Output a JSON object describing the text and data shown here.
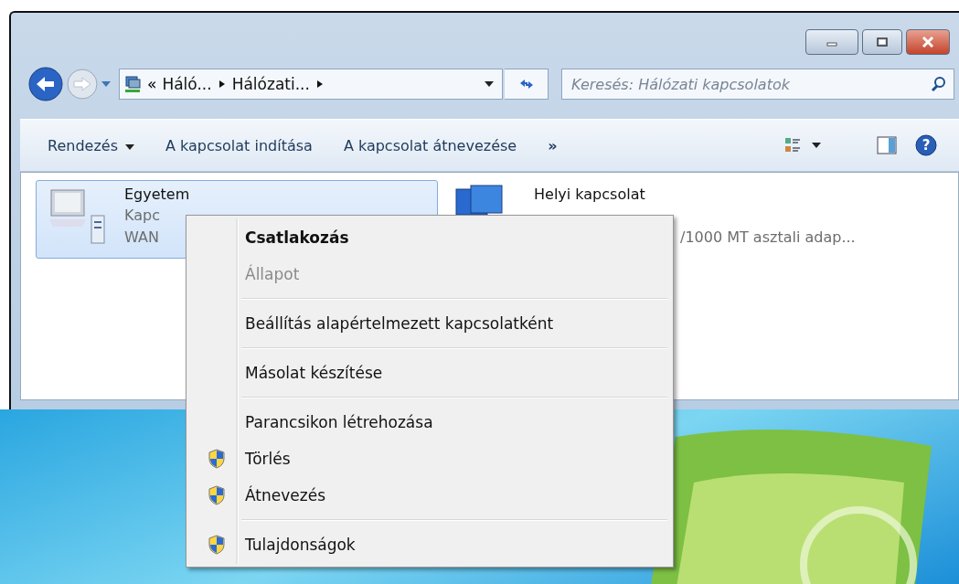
{
  "window": {
    "address": {
      "overflow": "«",
      "segments": [
        "Háló...",
        "Hálózati..."
      ]
    },
    "search": {
      "placeholder": "Keresés: Hálózati kapcsolatok"
    }
  },
  "toolbar": {
    "items": [
      {
        "label": "Rendezés",
        "dropdown": true
      },
      {
        "label": "A kapcsolat indítása",
        "dropdown": false
      },
      {
        "label": "A kapcsolat átnevezése",
        "dropdown": false
      }
    ],
    "more": "»",
    "help": "?"
  },
  "connections": [
    {
      "name": "Egyetem",
      "lines": [
        "Kapc",
        "WAN"
      ],
      "selected": true
    },
    {
      "name": "Helyi kapcsolat",
      "lines": [
        "/1000 MT asztali adap..."
      ],
      "selected": false
    }
  ],
  "context_menu": [
    {
      "kind": "item",
      "label": "Csatlakozás",
      "default": true,
      "disabled": false
    },
    {
      "kind": "item",
      "label": "Állapot",
      "default": false,
      "disabled": true
    },
    {
      "kind": "separator"
    },
    {
      "kind": "item",
      "label": "Beállítás alapértelmezett kapcsolatként",
      "default": false,
      "disabled": false
    },
    {
      "kind": "separator"
    },
    {
      "kind": "item",
      "label": "Másolat készítése",
      "default": false,
      "disabled": false
    },
    {
      "kind": "separator"
    },
    {
      "kind": "item",
      "label": "Parancsikon létrehozása",
      "default": false,
      "disabled": false
    },
    {
      "kind": "shield-item",
      "label": "Törlés",
      "default": false,
      "disabled": false
    },
    {
      "kind": "shield-item",
      "label": "Átnevezés",
      "default": false,
      "disabled": false
    },
    {
      "kind": "separator"
    },
    {
      "kind": "shield-item",
      "label": "Tulajdonságok",
      "default": false,
      "disabled": false
    }
  ]
}
